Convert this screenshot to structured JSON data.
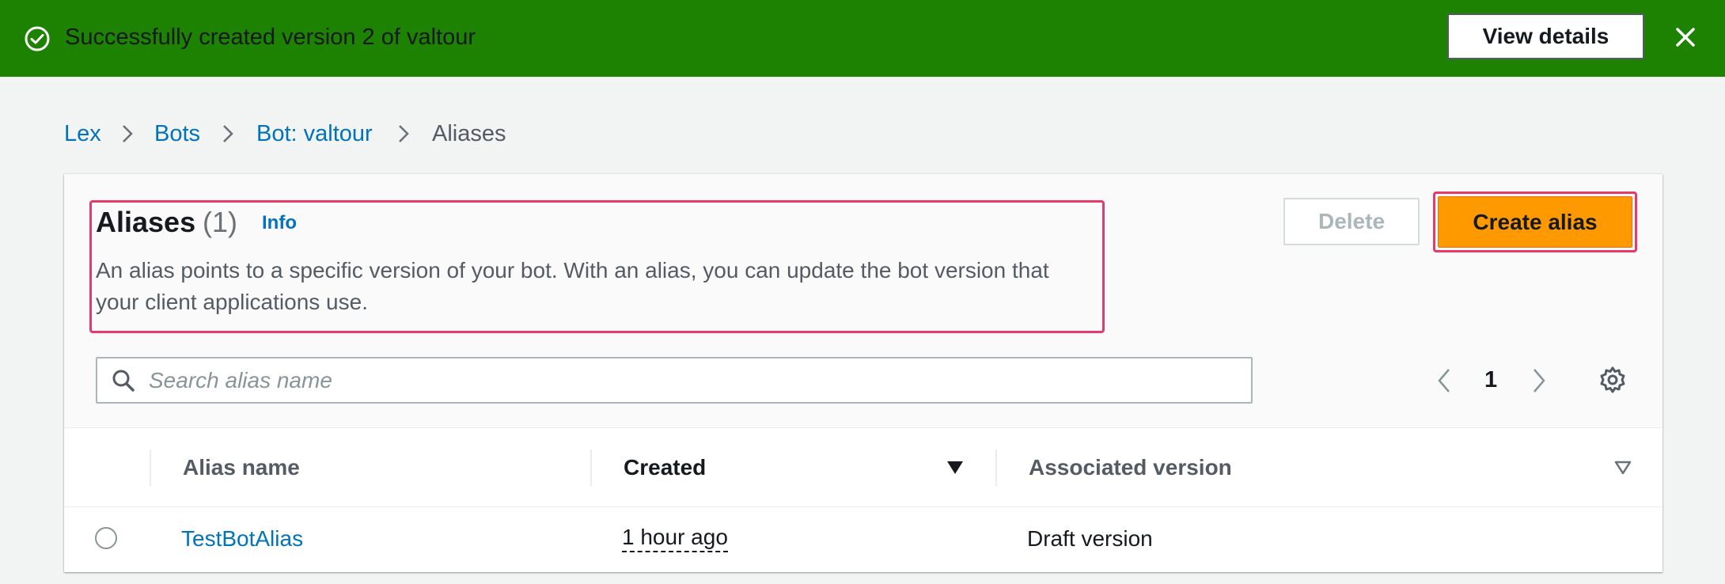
{
  "flash": {
    "message": "Successfully created version 2 of valtour",
    "action_label": "View details",
    "status": "success",
    "color": "#1d8102"
  },
  "breadcrumb": {
    "items": [
      "Lex",
      "Bots",
      "Bot: valtour",
      "Aliases"
    ]
  },
  "aliases_panel": {
    "title": "Aliases",
    "count": "(1)",
    "info_label": "Info",
    "description": "An alias points to a specific version of your bot. With an alias, you can update the bot version that your client applications use.",
    "delete_label": "Delete",
    "create_label": "Create alias",
    "accent_color": "#ff9900",
    "highlight_color": "#e8396b"
  },
  "search": {
    "placeholder": "Search alias name",
    "value": ""
  },
  "pagination": {
    "current_page": "1"
  },
  "table": {
    "columns": [
      "Alias name",
      "Created",
      "Associated version"
    ],
    "sorted_column": "Created",
    "rows": [
      {
        "alias_name": "TestBotAlias",
        "created": "1 hour ago",
        "version": "Draft version",
        "selected": false
      }
    ]
  },
  "icons": {
    "flash": "check-circle-icon",
    "close": "close-icon",
    "breadcrumb_separator": "chevron-right-icon",
    "search": "search-icon",
    "prev": "chevron-left-icon",
    "next": "chevron-right-icon",
    "settings": "gear-icon",
    "sort_desc": "caret-down-filled-icon",
    "sort_none": "caret-down-outline-icon"
  }
}
